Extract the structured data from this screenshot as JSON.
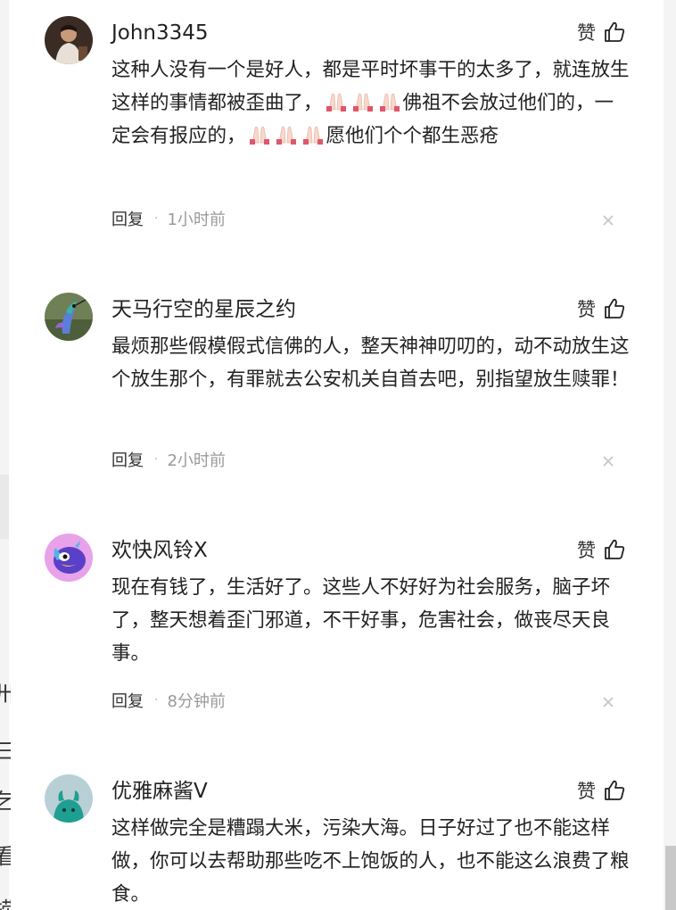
{
  "comments": [
    {
      "username": "John3345",
      "like_label": "赞",
      "text_parts": [
        "这种人没有一个是好人，都是平时坏事干的太多了，就连放生这样的事情都被歪曲了，",
        "佛祖不会放过他们的，一定会有报应的，",
        "愿他们个个都生恶疮"
      ],
      "emoji": "folded-hands-emoji",
      "reply_label": "回复",
      "separator": "·",
      "time": "1小时前",
      "avatar": "man-portrait-avatar"
    },
    {
      "username": "天马行空的星辰之约",
      "like_label": "赞",
      "text": "最烦那些假模假式信佛的人，整天神神叨叨的，动不动放生这个放生那个，有罪就去公安机关自首去吧，别指望放生赎罪！",
      "reply_label": "回复",
      "separator": "·",
      "time": "2小时前",
      "avatar": "hummingbird-avatar"
    },
    {
      "username": "欢快风铃X",
      "like_label": "赞",
      "text": "现在有钱了，生活好了。这些人不好好为社会服务，脑子坏了，整天想着歪门邪道，不干好事，危害社会，做丧尽天良事。",
      "reply_label": "回复",
      "separator": "·",
      "time": "8分钟前",
      "avatar": "cartoon-bird-avatar"
    },
    {
      "username": "优雅麻酱V",
      "like_label": "赞",
      "text": "这样做完全是糟蹋大米，污染大海。日子好过了也不能这样做，你可以去帮助那些吃不上饱饭的人，也不能这么浪费了粮食。",
      "avatar": "teal-creature-avatar"
    }
  ],
  "left_edge_glyphs": [
    "卅",
    "三",
    "乞",
    "看",
    "捞"
  ],
  "colors": {
    "text": "#222222",
    "muted": "#9a9a9a",
    "edge": "#f4f4f4"
  }
}
